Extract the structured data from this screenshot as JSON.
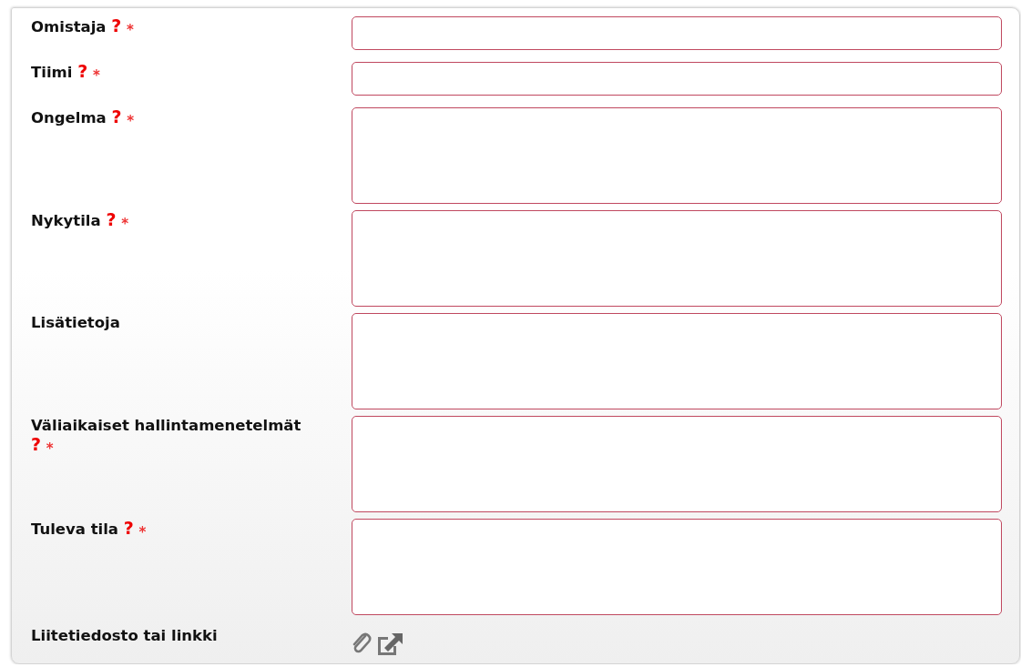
{
  "fields": [
    {
      "kind": "input",
      "label": "Omistaja",
      "help": "?",
      "required_mark": "*"
    },
    {
      "kind": "input",
      "label": "Tiimi",
      "help": "?",
      "required_mark": "*"
    },
    {
      "kind": "textarea",
      "label": "Ongelma",
      "help": "?",
      "required_mark": "*"
    },
    {
      "kind": "textarea",
      "label": "Nykytila",
      "help": "?",
      "required_mark": "*"
    },
    {
      "kind": "textarea",
      "label": "Lisätietoja"
    },
    {
      "kind": "textarea",
      "label": "Väliaikaiset hallintamenetelmät",
      "help": "?",
      "required_mark": "*"
    },
    {
      "kind": "textarea",
      "label": "Tuleva tila",
      "help": "?",
      "required_mark": "*"
    },
    {
      "kind": "attachment",
      "label": "Liitetiedosto tai linkki"
    }
  ]
}
